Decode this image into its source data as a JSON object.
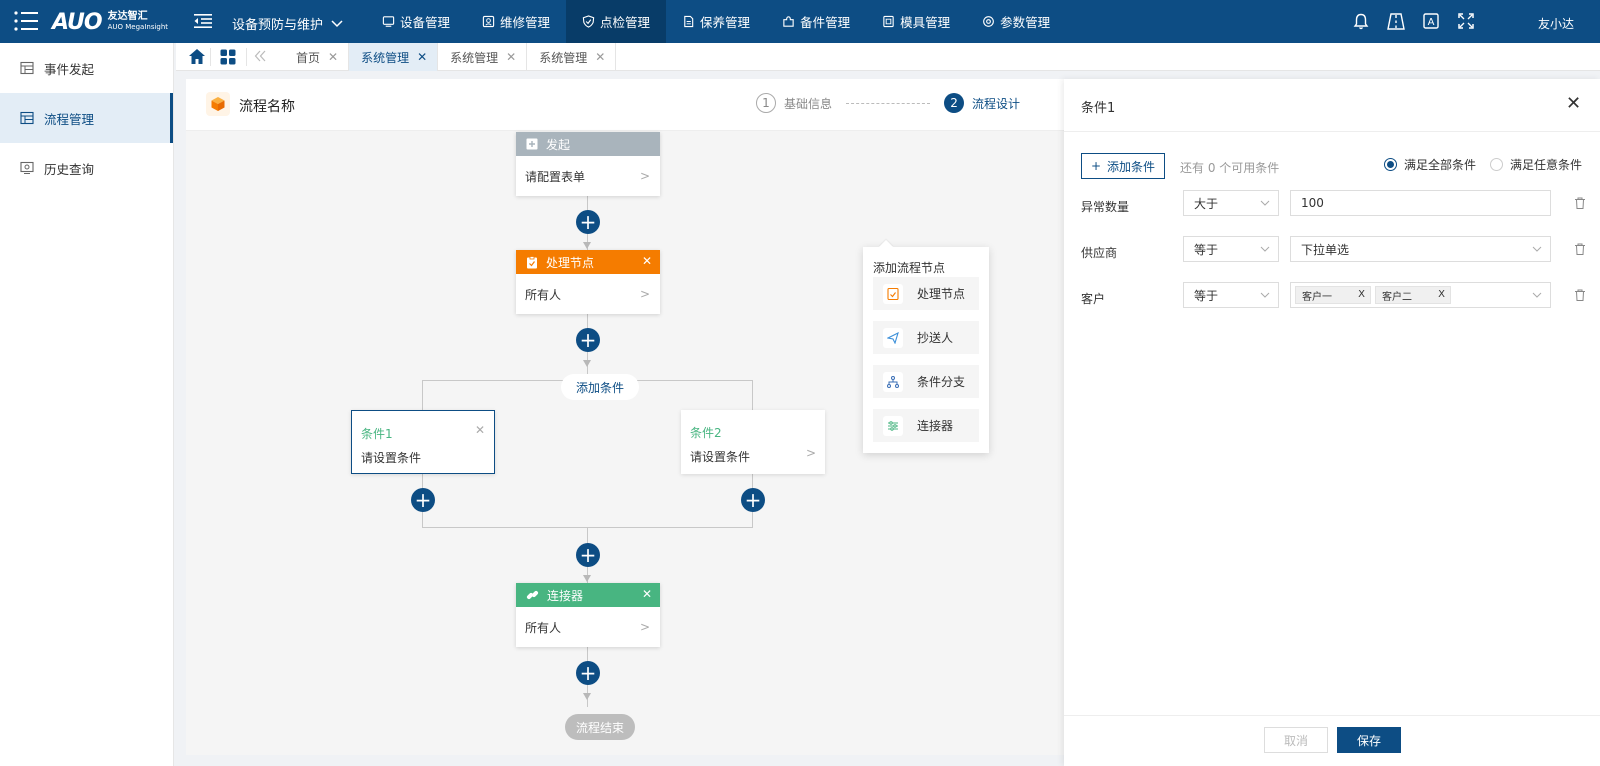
{
  "header": {
    "logo_mark": "AUO",
    "logo_cn": "友达智汇",
    "logo_en": "AUO MegaInsight",
    "module": "设备预防与维护",
    "navs": [
      {
        "label": "设备管理",
        "icon": "device-icon"
      },
      {
        "label": "维修管理",
        "icon": "repair-icon"
      },
      {
        "label": "点检管理",
        "icon": "shield-icon",
        "active": true
      },
      {
        "label": "保养管理",
        "icon": "doc-icon"
      },
      {
        "label": "备件管理",
        "icon": "puzzle-icon"
      },
      {
        "label": "模具管理",
        "icon": "mold-icon"
      },
      {
        "label": "参数管理",
        "icon": "gear-icon"
      }
    ],
    "user": "友小达",
    "lang_icon_text": "A"
  },
  "sidebar": {
    "items": [
      {
        "label": "事件发起",
        "icon": "calendar-grid-icon"
      },
      {
        "label": "流程管理",
        "icon": "calendar-grid-icon",
        "active": true
      },
      {
        "label": "历史查询",
        "icon": "monitor-icon"
      }
    ]
  },
  "tabs": [
    {
      "label": "首页"
    },
    {
      "label": "系统管理",
      "active": true
    },
    {
      "label": "系统管理"
    },
    {
      "label": "系统管理"
    }
  ],
  "main": {
    "title": "流程名称",
    "steps": [
      {
        "num": "1",
        "label": "基础信息"
      },
      {
        "num": "2",
        "label": "流程设计"
      }
    ]
  },
  "flow": {
    "start": {
      "title": "发起",
      "body": "请配置表单"
    },
    "process": {
      "title": "处理节点",
      "body": "所有人"
    },
    "add_condition": "添加条件",
    "conditions": [
      {
        "title": "条件1",
        "desc": "请设置条件"
      },
      {
        "title": "条件2",
        "desc": "请设置条件"
      }
    ],
    "connector": {
      "title": "连接器",
      "body": "所有人"
    },
    "end": "流程结束",
    "colors": {
      "start": "#a9b4bc",
      "process": "#f57c00",
      "connector": "#48b581",
      "accent": "#0d4d84"
    }
  },
  "popup": {
    "title": "添加流程节点",
    "items": [
      {
        "label": "处理节点",
        "icon": "clipboard-icon"
      },
      {
        "label": "抄送人",
        "icon": "send-icon"
      },
      {
        "label": "条件分支",
        "icon": "branch-icon"
      },
      {
        "label": "连接器",
        "icon": "connector-icon"
      }
    ]
  },
  "panel": {
    "title": "条件1",
    "add_condition": "添加条件",
    "remaining": "还有 0 个可用条件",
    "radio_all": "满足全部条件",
    "radio_any": "满足任意条件",
    "rows": [
      {
        "label": "异常数量",
        "operator": "大于",
        "value": "100"
      },
      {
        "label": "供应商",
        "operator": "等于",
        "value": "下拉单选"
      },
      {
        "label": "客户",
        "operator": "等于",
        "chips": [
          "客户一",
          "客户二"
        ]
      }
    ],
    "chip_close": "X",
    "cancel": "取消",
    "save": "保存"
  }
}
